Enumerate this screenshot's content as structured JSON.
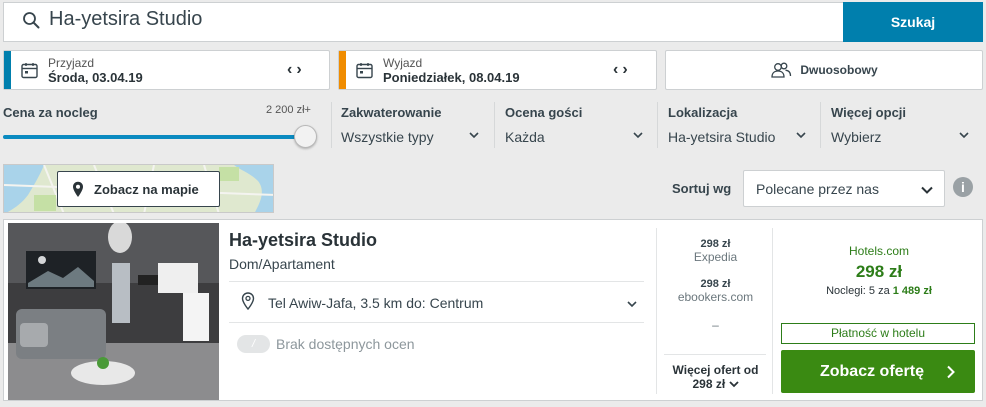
{
  "search": {
    "query": "Ha-yetsira Studio",
    "button_label": "Szukaj",
    "icon": "search-icon"
  },
  "checkin": {
    "label": "Przyjazd",
    "date": "Środa, 03.04.19",
    "accent": "#007fad"
  },
  "checkout": {
    "label": "Wyjazd",
    "date": "Poniedziałek, 08.04.19",
    "accent": "#f08c00"
  },
  "room": {
    "label": "Dwuosobowy",
    "icon": "guests-icon"
  },
  "filters": {
    "price": {
      "label": "Cena za nocleg",
      "max": "2 200 zł+",
      "fill": 1.0
    },
    "accommodation": {
      "label": "Zakwaterowanie",
      "value": "Wszystkie typy"
    },
    "rating": {
      "label": "Ocena gości",
      "value": "Każda"
    },
    "location": {
      "label": "Lokalizacja",
      "value": "Ha-yetsira Studio"
    },
    "more": {
      "label": "Więcej opcji",
      "value": "Wybierz"
    }
  },
  "map": {
    "button_label": "Zobacz na mapie"
  },
  "sort": {
    "label": "Sortuj wg",
    "selected": "Polecane przez nas",
    "info_icon": "i"
  },
  "result": {
    "name": "Ha-yetsira Studio",
    "type": "Dom/Apartament",
    "location": "Tel Awiw-Jafa, 3.5 km do: Centrum",
    "rating_badge": "/",
    "rating_text": "Brak dostępnych ocen",
    "alternatives": [
      {
        "price": "298 zł",
        "site": "Expedia"
      },
      {
        "price": "298 zł",
        "site": "ebookers.com"
      }
    ],
    "placeholder_dash": "–",
    "more_offers_label": "Więcej ofert od",
    "more_offers_price": "298 zł",
    "best": {
      "provider": "Hotels.com",
      "price": "298 zł",
      "nights_prefix": "Noclegi: 5 za",
      "nights_total": "1 489 zł",
      "payment_badge": "Płatność w hotelu",
      "button_label": "Zobacz ofertę"
    }
  },
  "colors": {
    "brand_blue": "#007fad",
    "deal_green": "#3a8a12",
    "price_green": "#2d7d19"
  }
}
